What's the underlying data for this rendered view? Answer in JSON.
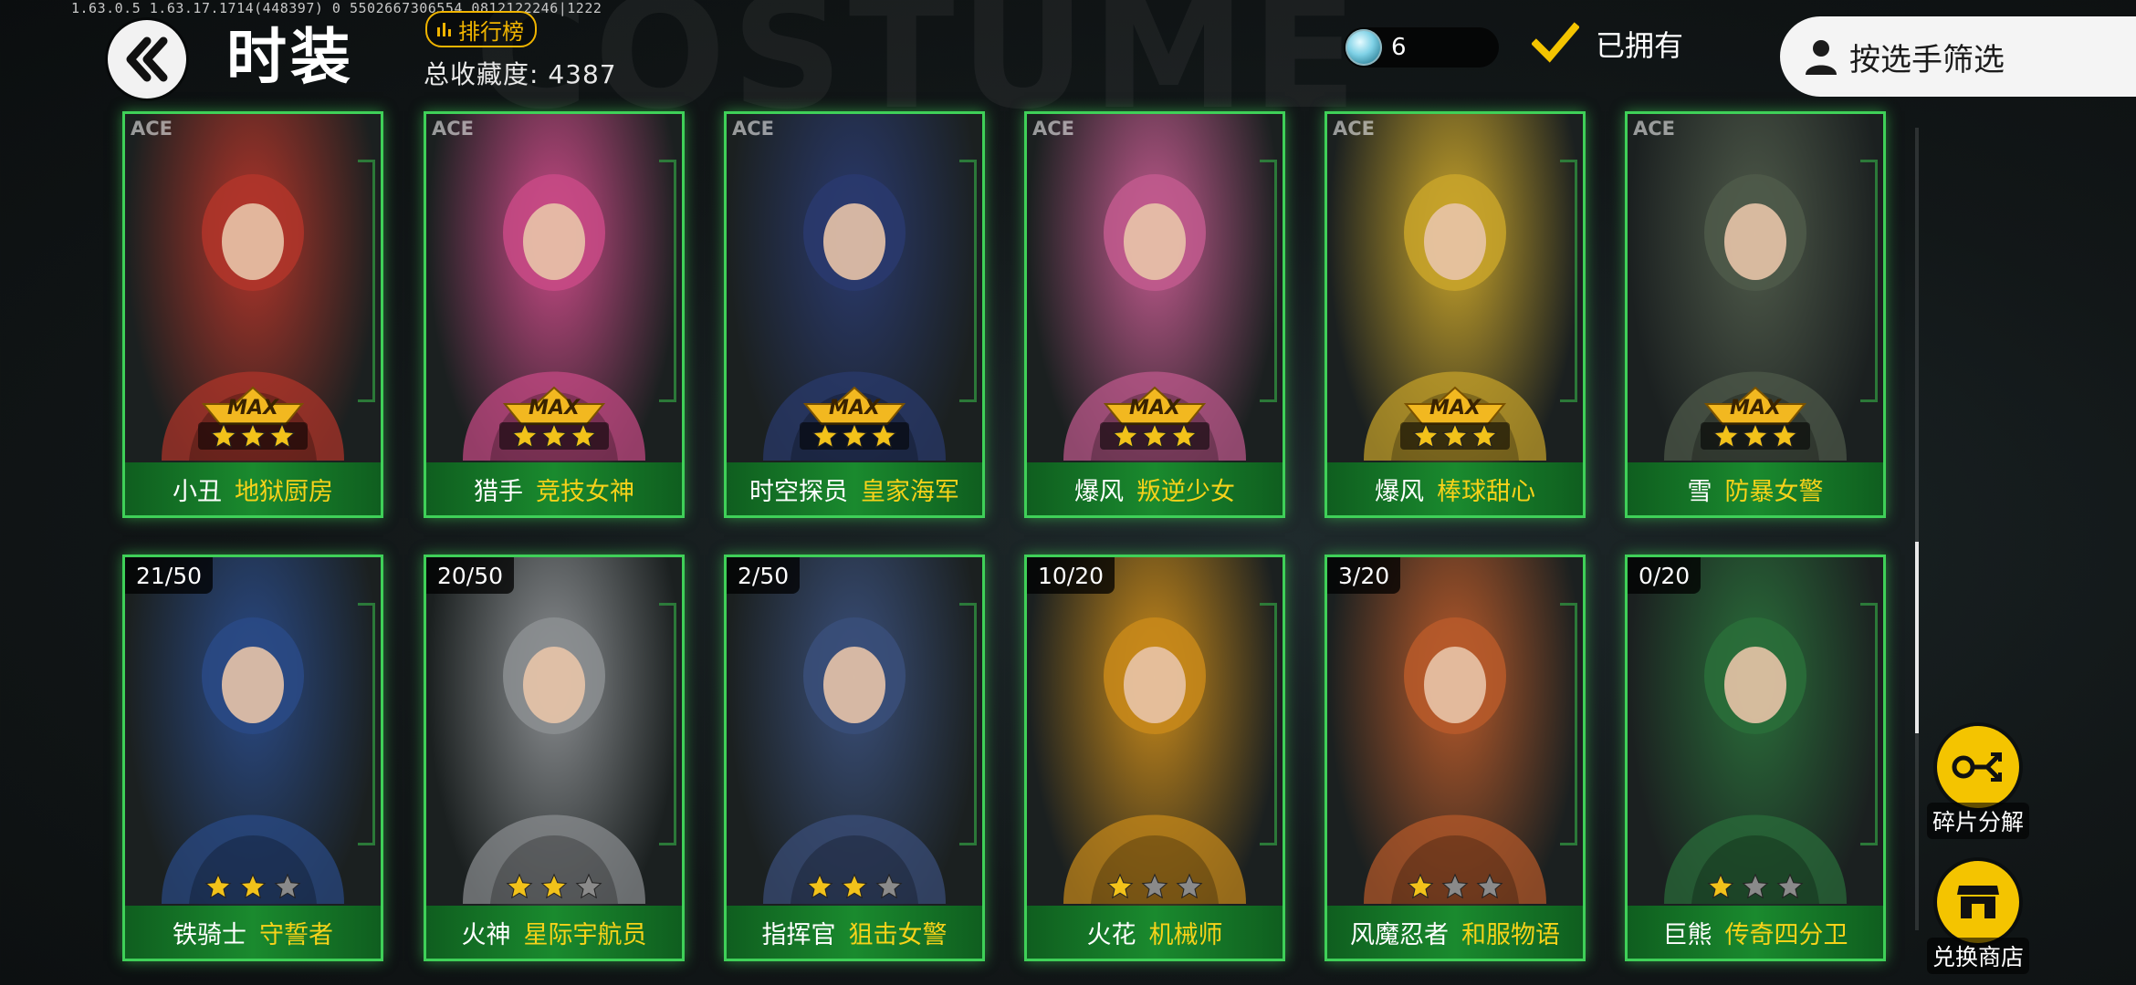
{
  "status": {
    "version": "1.63.0.5  1.63.17.1714(448397)  0  5502667306554  0812122246|1222"
  },
  "header": {
    "background_word": "COSTUME",
    "title": "时装",
    "rank_label": "排行榜",
    "collection_text": "总收藏度: 4387",
    "currency_value": "6",
    "owned_label": "已拥有",
    "owned_checked": true,
    "filter_label": "按选手筛选"
  },
  "cards": [
    {
      "ace": "ACE",
      "max": "MAX",
      "stars": 3,
      "name": "小丑",
      "skin": "地狱厨房",
      "art": "#b2352a"
    },
    {
      "ace": "ACE",
      "max": "MAX",
      "stars": 3,
      "name": "猎手",
      "skin": "竞技女神",
      "art": "#c94a86"
    },
    {
      "ace": "ACE",
      "max": "MAX",
      "stars": 3,
      "name": "时空探员",
      "skin": "皇家海军",
      "art": "#2a3a6e"
    },
    {
      "ace": "ACE",
      "max": "MAX",
      "stars": 3,
      "name": "爆风",
      "skin": "叛逆少女",
      "art": "#c25a8e"
    },
    {
      "ace": "ACE",
      "max": "MAX",
      "stars": 3,
      "name": "爆风",
      "skin": "棒球甜心",
      "art": "#c9a42a"
    },
    {
      "ace": "ACE",
      "max": "MAX",
      "stars": 3,
      "name": "雪",
      "skin": "防暴女警",
      "art": "#4f5a4a"
    },
    {
      "frag": "21/50",
      "stars": 2,
      "name": "铁骑士",
      "skin": "守誓者",
      "art": "#2a4a86"
    },
    {
      "frag": "20/50",
      "stars": 2,
      "name": "火神",
      "skin": "星际宇航员",
      "art": "#8c8f92"
    },
    {
      "frag": "2/50",
      "stars": 2,
      "name": "指挥官",
      "skin": "狙击女警",
      "art": "#3a4f7a"
    },
    {
      "frag": "10/20",
      "stars": 1,
      "name": "火花",
      "skin": "机械师",
      "art": "#c98a1a"
    },
    {
      "frag": "3/20",
      "stars": 1,
      "name": "风魔忍者",
      "skin": "和服物语",
      "art": "#b85a2a"
    },
    {
      "frag": "0/20",
      "stars": 1,
      "name": "巨熊",
      "skin": "传奇四分卫",
      "art": "#2a6e3a"
    }
  ],
  "side_buttons": {
    "decompose_label": "碎片分解",
    "shop_label": "兑换商店"
  },
  "colors": {
    "card_border": "#3fd058",
    "skin_text": "#f6d21a",
    "accent_yellow": "#f4c400"
  }
}
